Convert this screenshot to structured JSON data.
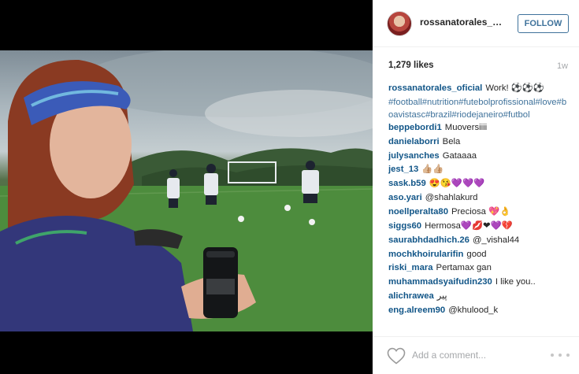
{
  "post": {
    "username": "rossanatorales_oficial",
    "follow_label": "FOLLOW",
    "likes": "1,279 likes",
    "age": "1w",
    "caption": {
      "user": "rossanatorales_oficial",
      "text": "Work! ⚽⚽⚽",
      "hashtags": "#football#nutrition#futebolprofissional#love#boavistasc#brazil#riodejaneiro#futbol"
    }
  },
  "comments": [
    {
      "user": "beppebordi1",
      "text": "Muoversiiii"
    },
    {
      "user": "danielaborri",
      "text": "Bela"
    },
    {
      "user": "julysanches",
      "text": "Gataaaa"
    },
    {
      "user": "jest_13",
      "text": "👍🏼👍🏼"
    },
    {
      "user": "sask.b59",
      "text": "😍😘💜💜💜"
    },
    {
      "user": "aso.yari",
      "text": "@shahlakurd"
    },
    {
      "user": "noellperalta80",
      "text": "Preciosa 💖👌"
    },
    {
      "user": "siggs60",
      "text": "Hermosa💜💋❤💜💔"
    },
    {
      "user": "saurabhdadhich.26",
      "text": "@_vishal44"
    },
    {
      "user": "mochkhoirularifin",
      "text": "good"
    },
    {
      "user": "riski_mara",
      "text": "Pertamax gan"
    },
    {
      "user": "muhammadsyaifudin230",
      "text": "I like you.."
    },
    {
      "user": "alichrawea",
      "text": "پیر"
    },
    {
      "user": "eng.alreem90",
      "text": "@khulood_k"
    }
  ],
  "footer": {
    "comment_placeholder": "Add a comment...",
    "heart_icon": "heart-outline-icon",
    "more_icon": "more-options-icon"
  },
  "colors": {
    "username_blue": "#125688",
    "hashtag_blue": "#3f729b",
    "follow_border": "#3f729b",
    "muted_gray": "#a5a7aa"
  }
}
